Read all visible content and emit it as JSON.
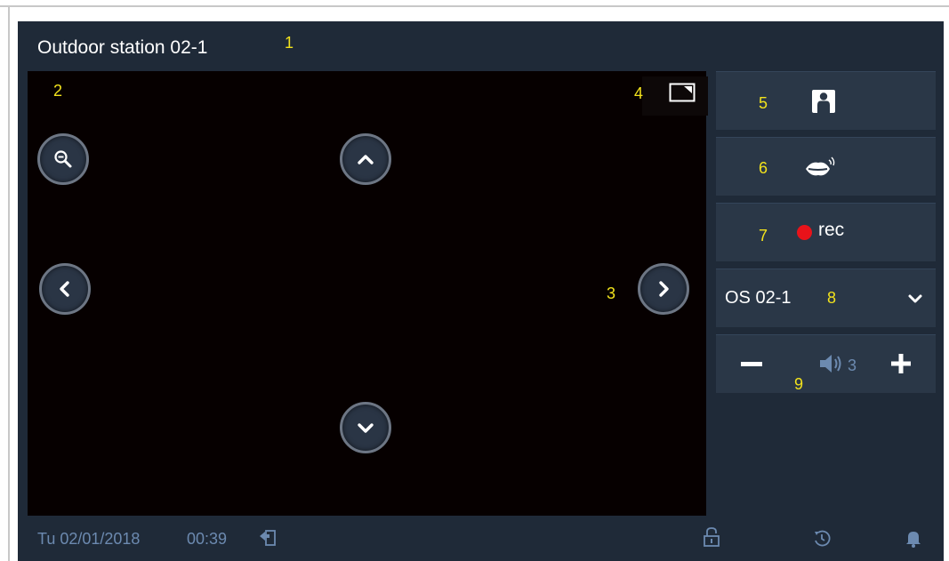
{
  "header": {
    "title": "Outdoor station 02-1",
    "callout": "1"
  },
  "video": {
    "callout_zoom": "2",
    "callout_right": "3",
    "callout_pip": "4",
    "icons": [
      "zoom-out-icon",
      "chevron-up-icon",
      "chevron-left-icon",
      "chevron-right-icon",
      "chevron-down-icon",
      "picture-in-picture-icon"
    ]
  },
  "side": {
    "snapshot": {
      "callout": "5",
      "icon": "person-photo-icon"
    },
    "talk": {
      "callout": "6",
      "icon": "talk-lips-icon"
    },
    "record": {
      "callout": "7",
      "label": "rec",
      "dot_color": "#e8131a"
    },
    "station": {
      "callout": "8",
      "selected": "OS 02-1",
      "icon": "chevron-down-icon"
    },
    "volume": {
      "callout": "9",
      "level": "3",
      "icons": [
        "minus-icon",
        "speaker-icon",
        "plus-icon"
      ]
    }
  },
  "status": {
    "date": "Tu 02/01/2018",
    "time": "00:39",
    "icons": [
      "exit-icon",
      "unlock-icon",
      "history-icon",
      "bell-icon"
    ]
  },
  "colors": {
    "screen_bg": "#1f2a38",
    "video_bg": "#060000",
    "callout": "#f2e21c",
    "status_text": "#6c8ab0"
  }
}
